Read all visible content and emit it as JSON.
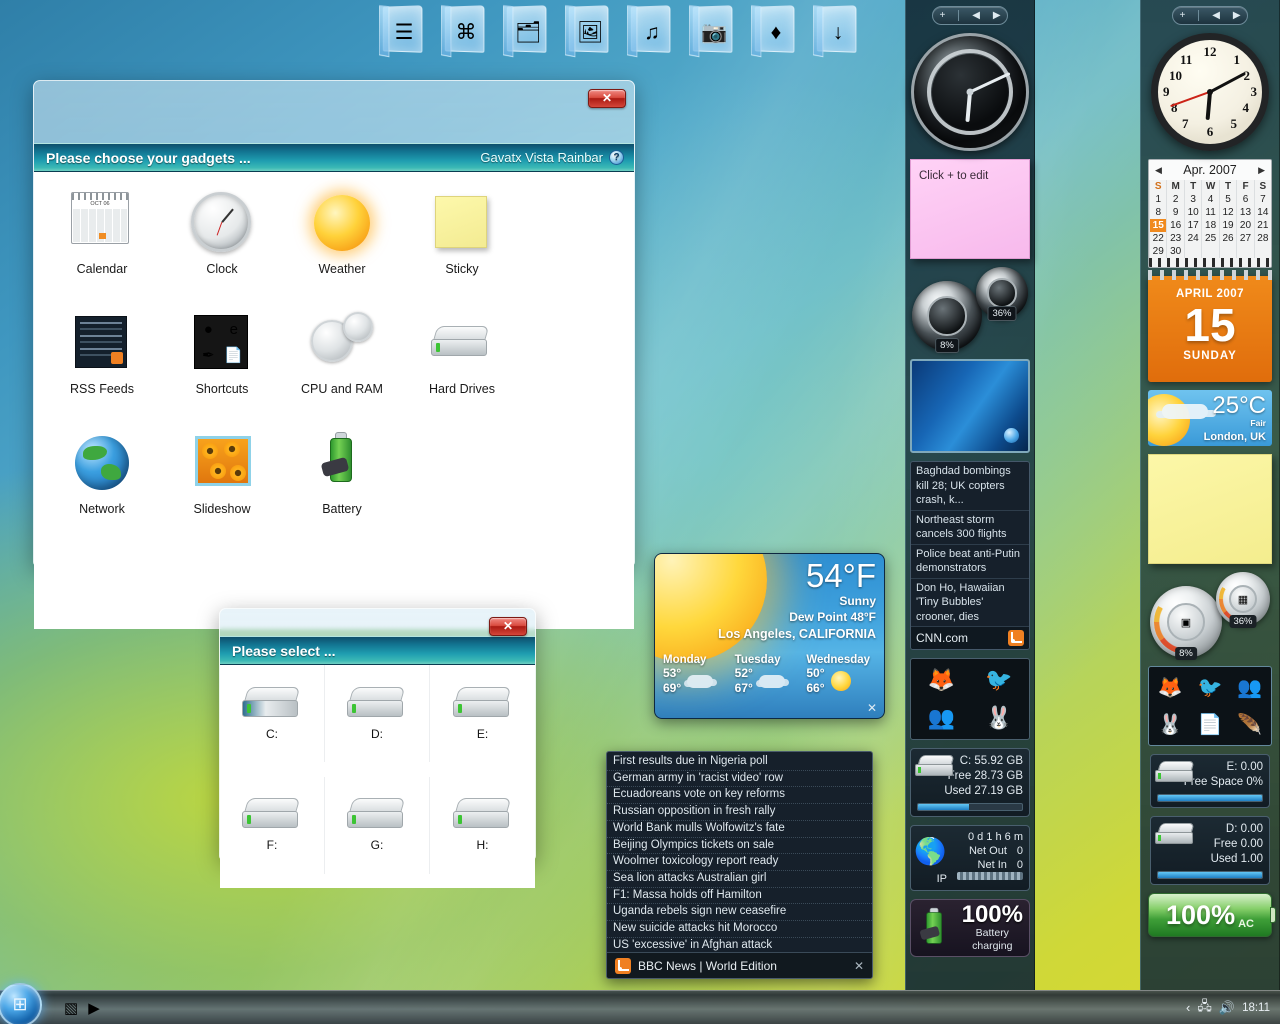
{
  "desktop": {
    "icons": [
      {
        "name": "documents-folder",
        "glyph": "☰"
      },
      {
        "name": "computer-folder",
        "glyph": "⌘"
      },
      {
        "name": "personal-folder",
        "glyph": "🗂"
      },
      {
        "name": "pictures-folder",
        "glyph": "🖼"
      },
      {
        "name": "music-folder",
        "glyph": "♫"
      },
      {
        "name": "video-folder",
        "glyph": "📷"
      },
      {
        "name": "games-folder",
        "glyph": "♦"
      },
      {
        "name": "downloads-folder",
        "glyph": "↓"
      }
    ]
  },
  "gadget_chooser": {
    "title": "Please choose your gadgets ...",
    "brand": "Gavatx Vista Rainbar",
    "help_label": "?",
    "close_label": "✕",
    "calendar_icon_month": "OCT 06",
    "items": [
      {
        "label": "Calendar",
        "icon": "calendar-icon"
      },
      {
        "label": "Clock",
        "icon": "clock-icon"
      },
      {
        "label": "Weather",
        "icon": "weather-sun-icon"
      },
      {
        "label": "Sticky",
        "icon": "sticky-note-icon"
      },
      {
        "label": "RSS Feeds",
        "icon": "rss-feeds-icon"
      },
      {
        "label": "Shortcuts",
        "icon": "shortcuts-icon"
      },
      {
        "label": "CPU and RAM",
        "icon": "cpu-ram-gauge-icon"
      },
      {
        "label": "Hard Drives",
        "icon": "hard-drive-icon"
      },
      {
        "label": "Network",
        "icon": "network-globe-icon"
      },
      {
        "label": "Slideshow",
        "icon": "slideshow-icon"
      },
      {
        "label": "Battery",
        "icon": "battery-icon"
      }
    ]
  },
  "drive_dialog": {
    "title": "Please select ...",
    "close_label": "✕",
    "drives": [
      {
        "label": "C:"
      },
      {
        "label": "D:"
      },
      {
        "label": "E:"
      },
      {
        "label": "F:"
      },
      {
        "label": "G:"
      },
      {
        "label": "H:"
      }
    ]
  },
  "weather_gadget": {
    "temperature": "54°F",
    "condition": "Sunny",
    "dew_point": "Dew Point 48°F",
    "location": "Los Angeles, CALIFORNIA",
    "close_label": "✕",
    "forecast": [
      {
        "day": "Monday",
        "low": "53°",
        "high": "69°",
        "icon": "cloud-icon"
      },
      {
        "day": "Tuesday",
        "low": "52°",
        "high": "67°",
        "icon": "cloud-icon"
      },
      {
        "day": "Wednesday",
        "low": "50°",
        "high": "66°",
        "icon": "sun-icon"
      }
    ]
  },
  "bbc_feed": {
    "source": "BBC News | World Edition",
    "close_label": "✕",
    "headlines": [
      "First results due in Nigeria poll",
      "German army in 'racist video' row",
      "Ecuadoreans vote on key reforms",
      "Russian opposition in fresh rally",
      "World Bank mulls Wolfowitz's fate",
      "Beijing Olympics tickets on sale",
      "Woolmer toxicology report ready",
      "Sea lion attacks Australian girl",
      "F1: Massa holds off Hamilton",
      "Uganda rebels sign new ceasefire",
      "New suicide attacks hit Morocco",
      "US 'excessive' in Afghan attack"
    ]
  },
  "sidebar_mid": {
    "controls": {
      "add": "+",
      "prev": "◀",
      "next": "▶"
    },
    "sticky_text": "Click + to edit",
    "cpu": {
      "cpu_pct": "8%",
      "ram_pct": "36%"
    },
    "cnn_feed": {
      "source": "CNN.com",
      "headlines": [
        "Baghdad bombings kill 28; UK copters crash, k...",
        "Northeast storm cancels 300 flights",
        "Police beat anti-Putin demonstrators",
        "Don Ho, Hawaiian 'Tiny Bubbles' crooner, dies"
      ]
    },
    "shortcuts": [
      {
        "name": "firefox-icon",
        "glyph": "🦊"
      },
      {
        "name": "thunderbird-icon",
        "glyph": "🐦"
      },
      {
        "name": "messenger-icon",
        "glyph": "👥"
      },
      {
        "name": "rabbit-icon",
        "glyph": "🐰"
      }
    ],
    "drive": {
      "title": "C:  55.92 GB",
      "free": "Free 28.73 GB",
      "used": "Used 27.19 GB",
      "fill_pct": 49
    },
    "network": {
      "uptime": "0 d 1 h 6 m",
      "net_out_label": "Net Out",
      "net_out": "0",
      "net_in_label": "Net In",
      "net_in": "0",
      "ip_label": "IP"
    },
    "battery": {
      "pct": "100%",
      "line1": "Battery",
      "line2": "charging"
    }
  },
  "sidebar_right": {
    "controls": {
      "add": "+",
      "prev": "◀",
      "next": "▶"
    },
    "calendar": {
      "month": "Apr. 2007",
      "prev": "◀",
      "next": "▶",
      "weekdays": [
        "S",
        "M",
        "T",
        "W",
        "T",
        "F",
        "S"
      ],
      "weeks": [
        [
          "1",
          "2",
          "3",
          "4",
          "5",
          "6",
          "7"
        ],
        [
          "8",
          "9",
          "10",
          "11",
          "12",
          "13",
          "14"
        ],
        [
          "15",
          "16",
          "17",
          "18",
          "19",
          "20",
          "21"
        ],
        [
          "22",
          "23",
          "24",
          "25",
          "26",
          "27",
          "28"
        ],
        [
          "29",
          "30",
          "",
          "",
          "",
          "",
          ""
        ]
      ],
      "selected": "15"
    },
    "date_gadget": {
      "month_year": "APRIL 2007",
      "day": "15",
      "weekday": "SUNDAY"
    },
    "weather": {
      "temp": "25°C",
      "condition": "Fair",
      "location": "London, UK"
    },
    "cpu": {
      "cpu_pct": "8%",
      "ram_pct": "36%"
    },
    "shortcuts": [
      {
        "name": "firefox-icon",
        "glyph": "🦊"
      },
      {
        "name": "thunderbird-icon",
        "glyph": "🐦"
      },
      {
        "name": "messenger-icon",
        "glyph": "👥"
      },
      {
        "name": "rabbit-icon",
        "glyph": "🐰"
      },
      {
        "name": "word-document-icon",
        "glyph": "📄"
      },
      {
        "name": "feather-editor-icon",
        "glyph": "🪶"
      }
    ],
    "drive_e": {
      "title": "E:  0.00",
      "sub": "Free Space 0%",
      "fill_pct": 100
    },
    "drive_d": {
      "title": "D:  0.00",
      "free": "Free 0.00",
      "used": "Used 1.00",
      "fill_pct": 100
    },
    "battery": {
      "pct": "100%",
      "mode": "AC"
    }
  },
  "taskbar": {
    "start_label": "⊞",
    "quick_launch": [
      {
        "name": "show-desktop-icon",
        "glyph": "▧"
      },
      {
        "name": "media-player-icon",
        "glyph": "▶"
      }
    ],
    "tray": {
      "chevron": "‹",
      "network-icon": "🖧",
      "volume-icon": "🔊",
      "time": "18:11"
    }
  }
}
